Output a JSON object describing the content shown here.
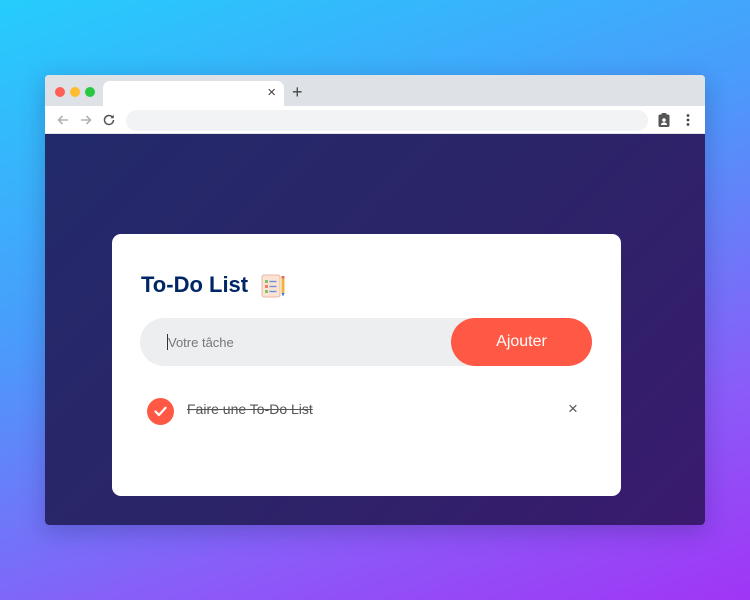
{
  "browser": {
    "tab": {
      "close_glyph": "×"
    },
    "new_tab_glyph": "+",
    "toolbar": {
      "back_icon": "arrow-left-icon",
      "forward_icon": "arrow-right-icon",
      "reload_icon": "reload-icon",
      "profile_icon": "clipboard-person-icon",
      "menu_icon": "kebab-menu-icon"
    }
  },
  "app": {
    "title": "To-Do List",
    "title_icon": "checklist-notepad-icon",
    "input": {
      "placeholder": "Votre tâche",
      "value": ""
    },
    "add_button_label": "Ajouter",
    "tasks": [
      {
        "text": "Faire une To-Do List",
        "checked": true,
        "delete_glyph": "×"
      }
    ]
  },
  "colors": {
    "accent": "#ff5945",
    "title": "#002765",
    "app_background": "#2b2468",
    "page_gradient_start": "#25cdfc",
    "page_gradient_end": "#a035f5"
  }
}
